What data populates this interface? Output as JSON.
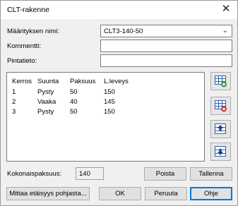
{
  "window": {
    "title": "CLT-rakenne"
  },
  "form": {
    "definition_label": "Määrityksen nimi:",
    "definition_value": "CLT3-140-50",
    "comment_label": "Kommentti:",
    "comment_value": "",
    "surface_label": "Pintatieto:",
    "surface_value": ""
  },
  "layers": {
    "columns": [
      "Kerros",
      "Suunta",
      "Paksuus",
      "L.leveys"
    ],
    "rows": [
      [
        "1",
        "Pysty",
        "50",
        "150"
      ],
      [
        "2",
        "Vaaka",
        "40",
        "145"
      ],
      [
        "3",
        "Pysty",
        "50",
        "150"
      ]
    ]
  },
  "side_buttons": [
    "add-layer-icon",
    "delete-layer-icon",
    "move-up-icon",
    "move-down-icon"
  ],
  "total": {
    "label": "Kokonaispaksuus:",
    "value": "140"
  },
  "buttons": {
    "remove": "Poista",
    "save": "Tallenna",
    "measure": "Mittaa etäisyys pohjasta...",
    "ok": "OK",
    "cancel": "Peruuta",
    "help": "Ohje"
  },
  "colors": {
    "add_green": "#3a9a3a",
    "delete_red": "#d03030",
    "grid_blue": "#2f5fb0"
  }
}
